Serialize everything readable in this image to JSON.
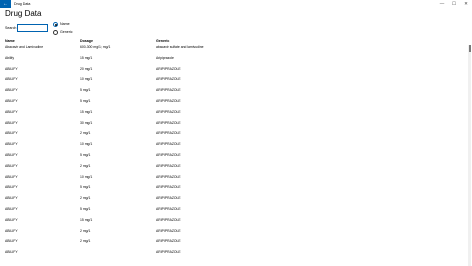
{
  "window": {
    "back_glyph": "←",
    "title": "Drug Data",
    "minimize_glyph": "—",
    "maximize_glyph": "☐",
    "close_glyph": "✕"
  },
  "page": {
    "title": "Drug Data"
  },
  "search": {
    "label": "Search",
    "value": "",
    "placeholder": ""
  },
  "filter": {
    "options": [
      {
        "label": "Name",
        "checked": true
      },
      {
        "label": "Generic",
        "checked": false
      }
    ]
  },
  "columns": {
    "name": "Name",
    "dosage": "Dosage",
    "generic": "Generic"
  },
  "rows": [
    {
      "name": "Abacavir and Lamivudine",
      "dosage": "600-300 mg/1; mg/1",
      "generic": "abacavir sulfate and lamivudine"
    },
    {
      "name": "Abilify",
      "dosage": "15 mg/1",
      "generic": "Aripiprazole"
    },
    {
      "name": "ABILIFY",
      "dosage": "20 mg/1",
      "generic": "ARIPIPRAZOLE"
    },
    {
      "name": "ABILIFY",
      "dosage": "10 mg/1",
      "generic": "ARIPIPRAZOLE"
    },
    {
      "name": "ABILIFY",
      "dosage": "5 mg/1",
      "generic": "ARIPIPRAZOLE"
    },
    {
      "name": "ABILIFY",
      "dosage": "5 mg/1",
      "generic": "ARIPIPRAZOLE"
    },
    {
      "name": "ABILIFY",
      "dosage": "15 mg/1",
      "generic": "ARIPIPRAZOLE"
    },
    {
      "name": "ABILIFY",
      "dosage": "30 mg/1",
      "generic": "ARIPIPRAZOLE"
    },
    {
      "name": "ABILIFY",
      "dosage": "2 mg/1",
      "generic": "ARIPIPRAZOLE"
    },
    {
      "name": "ABILIFY",
      "dosage": "10 mg/1",
      "generic": "ARIPIPRAZOLE"
    },
    {
      "name": "ABILIFY",
      "dosage": "5 mg/1",
      "generic": "ARIPIPRAZOLE"
    },
    {
      "name": "ABILIFY",
      "dosage": "2 mg/1",
      "generic": "ARIPIPRAZOLE"
    },
    {
      "name": "ABILIFY",
      "dosage": "10 mg/1",
      "generic": "ARIPIPRAZOLE"
    },
    {
      "name": "ABILIFY",
      "dosage": "5 mg/1",
      "generic": "ARIPIPRAZOLE"
    },
    {
      "name": "ABILIFY",
      "dosage": "2 mg/1",
      "generic": "ARIPIPRAZOLE"
    },
    {
      "name": "ABILIFY",
      "dosage": "5 mg/1",
      "generic": "ARIPIPRAZOLE"
    },
    {
      "name": "ABILIFY",
      "dosage": "15 mg/1",
      "generic": "ARIPIPRAZOLE"
    },
    {
      "name": "ABILIFY",
      "dosage": "2 mg/1",
      "generic": "ARIPIPRAZOLE"
    },
    {
      "name": "ABILIFY",
      "dosage": "2 mg/1",
      "generic": "ARIPIPRAZOLE"
    },
    {
      "name": "ABILIFY",
      "dosage": "",
      "generic": "ARIPIPRAZOLE"
    }
  ]
}
